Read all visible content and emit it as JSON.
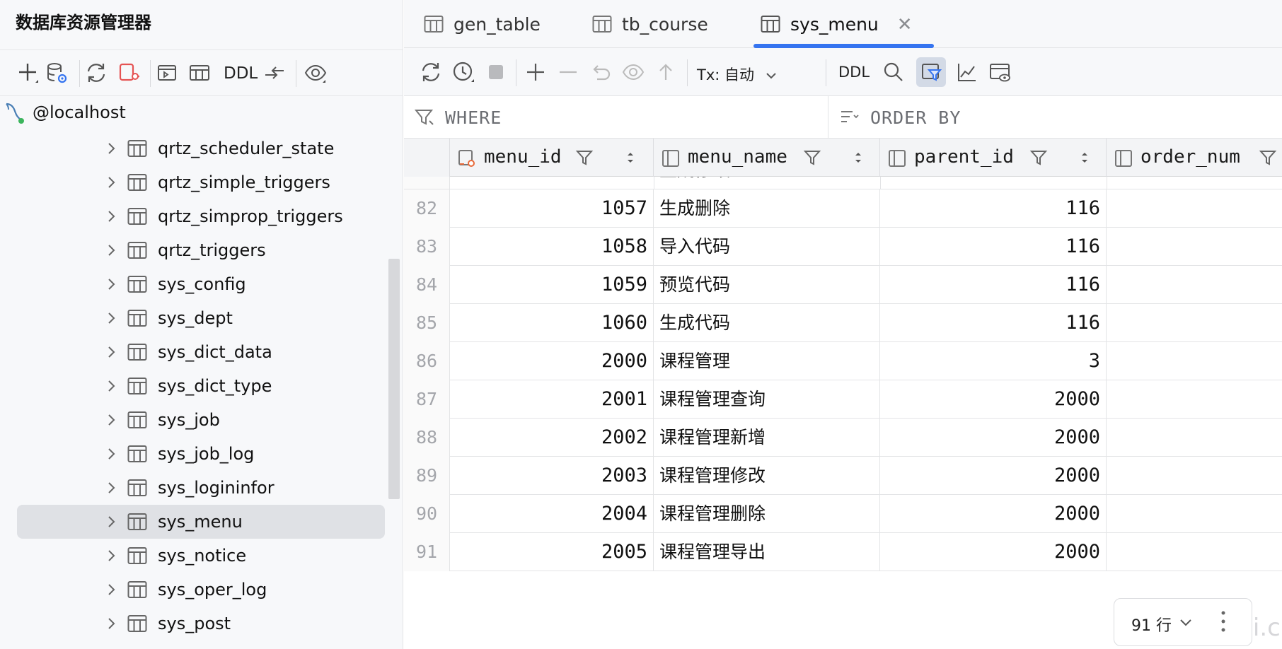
{
  "left_panel": {
    "title": "数据库资源管理器",
    "toolbar": {
      "ddl_label": "DDL"
    },
    "host": {
      "label": "@localhost"
    },
    "tables": [
      {
        "label": "qrtz_scheduler_state",
        "selected": false
      },
      {
        "label": "qrtz_simple_triggers",
        "selected": false
      },
      {
        "label": "qrtz_simprop_triggers",
        "selected": false
      },
      {
        "label": "qrtz_triggers",
        "selected": false
      },
      {
        "label": "sys_config",
        "selected": false
      },
      {
        "label": "sys_dept",
        "selected": false
      },
      {
        "label": "sys_dict_data",
        "selected": false
      },
      {
        "label": "sys_dict_type",
        "selected": false
      },
      {
        "label": "sys_job",
        "selected": false
      },
      {
        "label": "sys_job_log",
        "selected": false
      },
      {
        "label": "sys_logininfor",
        "selected": false
      },
      {
        "label": "sys_menu",
        "selected": true
      },
      {
        "label": "sys_notice",
        "selected": false
      },
      {
        "label": "sys_oper_log",
        "selected": false
      },
      {
        "label": "sys_post",
        "selected": false
      }
    ]
  },
  "tabs": [
    {
      "label": "gen_table",
      "active": false
    },
    {
      "label": "tb_course",
      "active": false
    },
    {
      "label": "sys_menu",
      "active": true,
      "close": "✕"
    }
  ],
  "data_toolbar": {
    "tx_label": "Tx: 自动",
    "ddl_label": "DDL"
  },
  "filter": {
    "where_label": "WHERE",
    "order_by_label": "ORDER BY"
  },
  "columns": [
    {
      "name": "menu_id"
    },
    {
      "name": "menu_name"
    },
    {
      "name": "parent_id"
    },
    {
      "name": "order_num"
    }
  ],
  "rows": [
    {
      "rn": "82",
      "menu_id": "1057",
      "menu_name": "生成删除",
      "parent_id": "116"
    },
    {
      "rn": "83",
      "menu_id": "1058",
      "menu_name": "导入代码",
      "parent_id": "116"
    },
    {
      "rn": "84",
      "menu_id": "1059",
      "menu_name": "预览代码",
      "parent_id": "116"
    },
    {
      "rn": "85",
      "menu_id": "1060",
      "menu_name": "生成代码",
      "parent_id": "116"
    },
    {
      "rn": "86",
      "menu_id": "2000",
      "menu_name": "课程管理",
      "parent_id": "3"
    },
    {
      "rn": "87",
      "menu_id": "2001",
      "menu_name": "课程管理查询",
      "parent_id": "2000"
    },
    {
      "rn": "88",
      "menu_id": "2002",
      "menu_name": "课程管理新增",
      "parent_id": "2000"
    },
    {
      "rn": "89",
      "menu_id": "2003",
      "menu_name": "课程管理修改",
      "parent_id": "2000"
    },
    {
      "rn": "90",
      "menu_id": "2004",
      "menu_name": "课程管理删除",
      "parent_id": "2000"
    },
    {
      "rn": "91",
      "menu_id": "2005",
      "menu_name": "课程管理导出",
      "parent_id": "2000"
    }
  ],
  "partial_row": {
    "menu_name": "生成修改"
  },
  "row_count": {
    "label": "91 行"
  },
  "watermark": "jinhei.cn",
  "colors": {
    "accent": "#3574f0",
    "selected_row_bg": "#dfe1e5",
    "panel_bg": "#f7f8fa",
    "pk_icon": "#e86a3a"
  }
}
